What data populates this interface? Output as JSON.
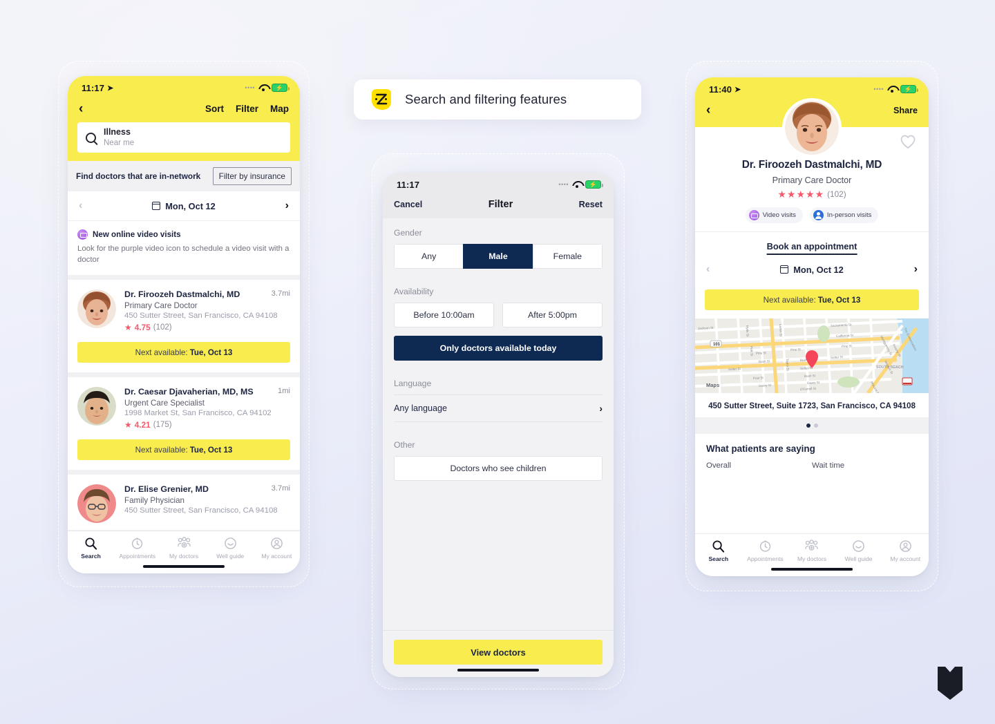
{
  "badge": {
    "title": "Search and filtering features",
    "logo_icon": "zocdoc-logo-icon"
  },
  "brand": {
    "yellow": "#F9EC4F",
    "navy": "#0E2A52",
    "pink": "#F5596B",
    "purple": "#9B4FE0",
    "blue": "#2D6FD8"
  },
  "corner_logo": {
    "name": "ms-shield-logo"
  },
  "phone_search": {
    "status": {
      "time": "11:17",
      "location_icon": "location-arrow-icon",
      "signal_dots": "••••",
      "wifi_icon": "wifi-icon",
      "battery_icon": "battery-charging-icon"
    },
    "nav": {
      "back_icon": "chevron-left-icon",
      "links": [
        "Sort",
        "Filter",
        "Map"
      ]
    },
    "search": {
      "icon": "search-icon",
      "value": "Illness",
      "sub": "Near me"
    },
    "network": {
      "label": "Find doctors that are in-network",
      "button": "Filter by insurance"
    },
    "date_picker": {
      "prev_icon": "chevron-left-icon",
      "calendar_icon": "calendar-icon",
      "date": "Mon, Oct 12",
      "next_icon": "chevron-right-icon"
    },
    "promo": {
      "icon": "video-camera-icon",
      "title": "New online video visits",
      "body": "Look for the purple video icon to schedule a video visit with a doctor"
    },
    "doctors": [
      {
        "name": "Dr. Firoozeh Dastmalchi, MD",
        "distance": "3.7mi",
        "specialty": "Primary Care Doctor",
        "address": "450 Sutter Street, San Francisco, CA 94108",
        "rating": "4.75",
        "reviews": "(102)",
        "next_label": "Next available:",
        "next_date": "Tue, Oct 13"
      },
      {
        "name": "Dr. Caesar Djavaherian, MD, MS",
        "distance": "1mi",
        "specialty": "Urgent Care Specialist",
        "address": "1998 Market St, San Francisco, CA 94102",
        "rating": "4.21",
        "reviews": "(175)",
        "next_label": "Next available:",
        "next_date": "Tue, Oct 13"
      },
      {
        "name": "Dr. Elise Grenier, MD",
        "distance": "3.7mi",
        "specialty": "Family Physician",
        "address": "450 Sutter Street, San Francisco, CA 94108",
        "rating": "",
        "reviews": "",
        "next_label": "",
        "next_date": ""
      }
    ],
    "tabs": [
      {
        "label": "Search",
        "icon": "search-icon",
        "active": true
      },
      {
        "label": "Appointments",
        "icon": "clock-icon",
        "active": false
      },
      {
        "label": "My doctors",
        "icon": "people-icon",
        "active": false
      },
      {
        "label": "Well guide",
        "icon": "smiley-icon",
        "active": false
      },
      {
        "label": "My account",
        "icon": "account-circle-icon",
        "active": false
      }
    ]
  },
  "phone_filter": {
    "status": {
      "time": "11:17",
      "signal_dots": "••••",
      "wifi_icon": "wifi-icon",
      "battery_icon": "battery-charging-icon"
    },
    "header": {
      "cancel": "Cancel",
      "title": "Filter",
      "reset": "Reset"
    },
    "gender": {
      "section": "Gender",
      "options": [
        "Any",
        "Male",
        "Female"
      ],
      "selected": "Male"
    },
    "availability": {
      "section": "Availability",
      "options": [
        "Before 10:00am",
        "After 5:00pm"
      ],
      "today_button": "Only doctors available today",
      "today_selected": true
    },
    "language": {
      "section": "Language",
      "value": "Any language",
      "chevron_icon": "chevron-right-icon"
    },
    "other": {
      "section": "Other",
      "option": "Doctors who see children"
    },
    "footer": {
      "view_button": "View doctors"
    }
  },
  "phone_profile": {
    "status": {
      "time": "11:40",
      "location_icon": "location-arrow-icon",
      "signal_dots": "••••",
      "wifi_icon": "wifi-icon",
      "battery_icon": "battery-charging-icon"
    },
    "nav": {
      "back_icon": "chevron-left-icon",
      "share": "Share",
      "favorite_icon": "heart-outline-icon"
    },
    "doctor": {
      "name": "Dr. Firoozeh Dastmalchi, MD",
      "specialty": "Primary Care Doctor",
      "stars": "★★★★★",
      "review_count": "(102)"
    },
    "visit_pills": [
      {
        "label": "Video visits",
        "icon": "video-camera-icon"
      },
      {
        "label": "In-person visits",
        "icon": "person-icon"
      }
    ],
    "booking": {
      "title": "Book an appointment",
      "prev_icon": "chevron-left-icon",
      "calendar_icon": "calendar-icon",
      "date": "Mon, Oct 12",
      "next_icon": "chevron-right-icon",
      "next_label": "Next available:",
      "next_date": "Tue, Oct 13"
    },
    "map": {
      "attribution": "Maps",
      "pin_icon": "map-pin-icon",
      "highway": "101",
      "neighborhood": "SOUTH BEACH",
      "streets": [
        "Jackson St",
        "Sacramento St",
        "California St",
        "Pine St",
        "Bush St",
        "Sutter St",
        "Post St",
        "Geary St",
        "O'Farrell St",
        "Market St",
        "Mission St",
        "Taylor St",
        "Larkin St"
      ]
    },
    "address": "450 Sutter Street, Suite 1723, San Francisco, CA 94108",
    "carousel": {
      "count": 2,
      "active": 0
    },
    "reviews": {
      "title": "What patients are saying",
      "columns": [
        "Overall",
        "Wait time"
      ]
    },
    "tabs": [
      {
        "label": "Search",
        "icon": "search-icon",
        "active": true
      },
      {
        "label": "Appointments",
        "icon": "clock-icon",
        "active": false
      },
      {
        "label": "My doctors",
        "icon": "people-icon",
        "active": false
      },
      {
        "label": "Well guide",
        "icon": "smiley-icon",
        "active": false
      },
      {
        "label": "My account",
        "icon": "account-circle-icon",
        "active": false
      }
    ]
  }
}
